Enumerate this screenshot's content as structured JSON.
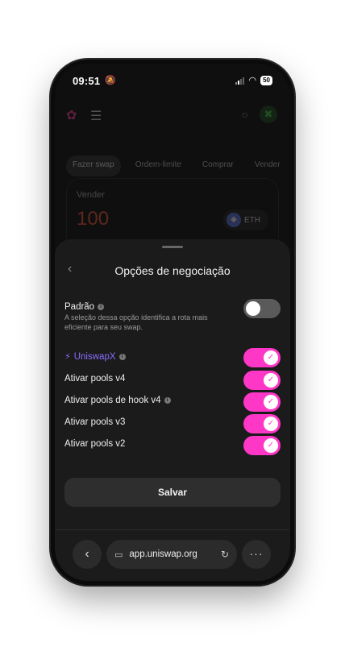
{
  "status_bar": {
    "time": "09:51",
    "battery": "50"
  },
  "app": {
    "tabs": [
      {
        "label": "Fazer swap"
      },
      {
        "label": "Ordem-limite"
      },
      {
        "label": "Comprar"
      },
      {
        "label": "Vender"
      }
    ],
    "sell_card": {
      "label": "Vender",
      "amount": "100",
      "token": "ETH"
    }
  },
  "sheet": {
    "title": "Opções de negociação",
    "default_option": {
      "label": "Padrão",
      "description": "A seleção dessa opção identifica a rota mais eficiente para seu swap.",
      "enabled": false
    },
    "options": [
      {
        "label": "UniswapX",
        "enabled": true
      },
      {
        "label": "Ativar pools v4",
        "enabled": true
      },
      {
        "label": "Ativar pools de hook v4",
        "enabled": true
      },
      {
        "label": "Ativar pools v3",
        "enabled": true
      },
      {
        "label": "Ativar pools v2",
        "enabled": true
      }
    ],
    "save_label": "Salvar"
  },
  "browser": {
    "url": "app.uniswap.org"
  },
  "colors": {
    "accent_toggle": "#ff37c7",
    "uniswapx": "#8b6cff",
    "sell_amount": "#ff5a3d"
  }
}
